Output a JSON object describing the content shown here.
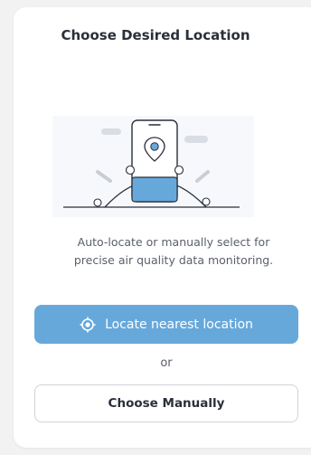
{
  "title": "Choose Desired Location",
  "description_line1": "Auto-locate or manually select for",
  "description_line2": "precise air quality data monitoring.",
  "locate_button": {
    "label": "Locate nearest location",
    "icon": "crosshair-icon"
  },
  "separator": "or",
  "manual_button": {
    "label": "Choose Manually"
  },
  "colors": {
    "accent": "#67a8db",
    "text_dark": "#2a2f3a",
    "text_muted": "#5a5f6a"
  }
}
